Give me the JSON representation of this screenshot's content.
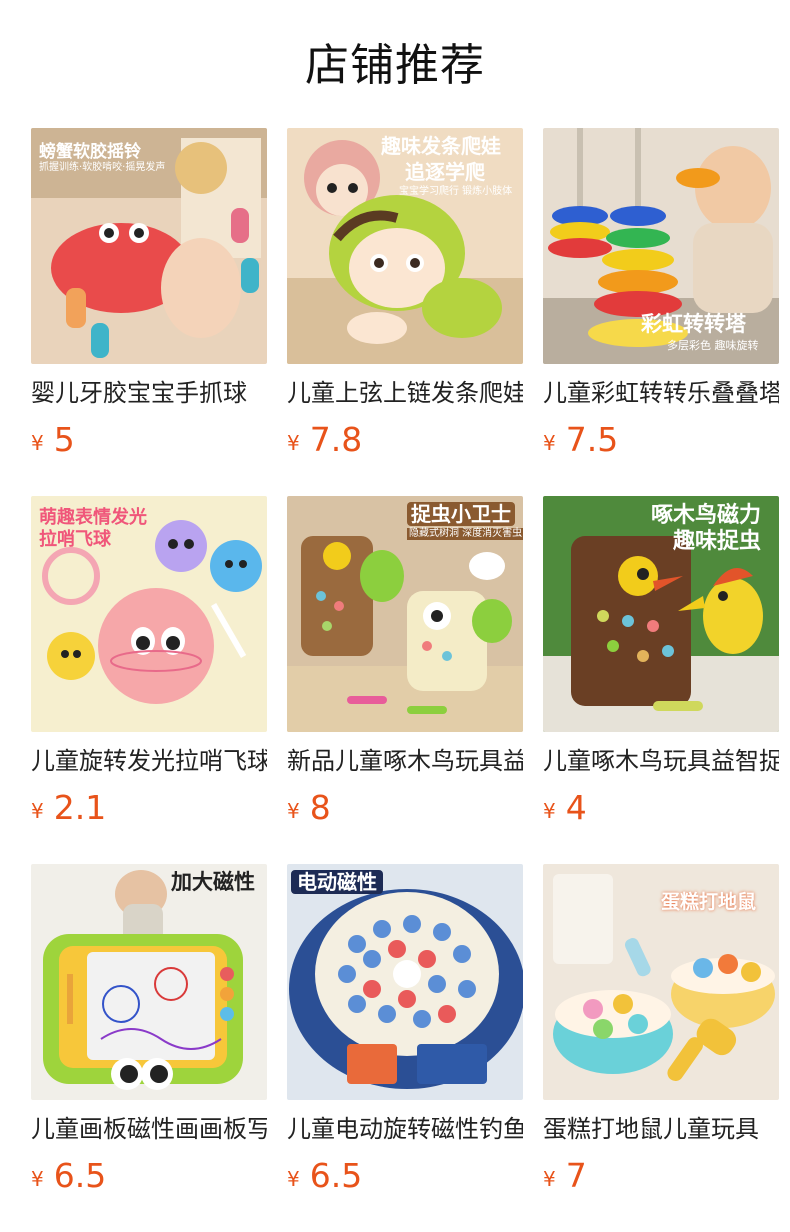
{
  "header": {
    "title": "店铺推荐"
  },
  "accent_color": "#e8531a",
  "currency_symbol": "¥",
  "products": [
    {
      "name": "婴儿牙胶宝宝手抓球",
      "price": "5",
      "image": {
        "tag": "螃蟹软胶摇铃",
        "sub": "抓握训练·软胶啃咬·摇晃发声",
        "icon": "crab-teether-icon"
      }
    },
    {
      "name": "儿童上弦上链发条爬娃",
      "price": "7.8",
      "image": {
        "tag": "趣味发条爬娃",
        "tag2": "追逐学爬",
        "sub": "宝宝学习爬行 锻炼小肢体",
        "icon": "crawling-doll-icon"
      }
    },
    {
      "name": "儿童彩虹转转乐叠叠塔",
      "price": "7.5",
      "image": {
        "tag": "彩虹转转塔",
        "sub": "多层彩色 趣味旋转",
        "icon": "rainbow-tower-icon"
      }
    },
    {
      "name": "儿童旋转发光拉哨飞球",
      "price": "2.1",
      "image": {
        "tag": "萌趣表情发光",
        "tag2": "拉哨飞球",
        "icon": "whistle-ball-icon"
      }
    },
    {
      "name": "新品儿童啄木鸟玩具益智",
      "price": "8",
      "image": {
        "tag": "捉虫小卫士",
        "sub": "隐藏式树洞 深度消灭害虫",
        "icon": "woodpecker-icon"
      }
    },
    {
      "name": "儿童啄木鸟玩具益智捉虫",
      "price": "4",
      "image": {
        "tag": "啄木鸟磁力",
        "tag2": "趣味捉虫",
        "icon": "woodpecker-tree-icon"
      }
    },
    {
      "name": "儿童画板磁性画画板写字",
      "price": "6.5",
      "image": {
        "tag": "加大磁性",
        "icon": "drawing-board-icon"
      }
    },
    {
      "name": "儿童电动旋转磁性钓鱼",
      "price": "6.5",
      "image": {
        "tag": "电动磁性",
        "icon": "fishing-game-icon"
      }
    },
    {
      "name": "蛋糕打地鼠儿童玩具",
      "price": "7",
      "image": {
        "tag": "蛋糕打地鼠",
        "icon": "whack-a-mole-icon"
      }
    }
  ]
}
